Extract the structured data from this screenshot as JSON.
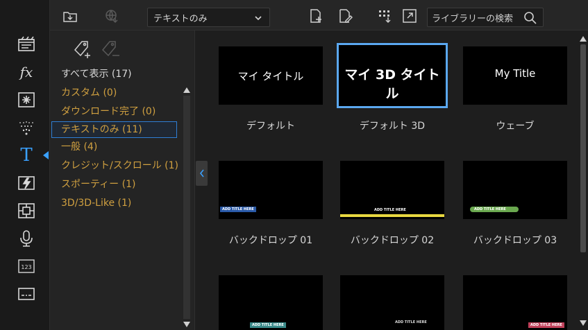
{
  "rail": {
    "items": [
      {
        "icon": "clapperboard-icon"
      },
      {
        "icon": "fx-icon",
        "text": "fx"
      },
      {
        "icon": "particle-icon"
      },
      {
        "icon": "sparkle-icon"
      },
      {
        "icon": "title-icon",
        "text": "T",
        "active": true
      },
      {
        "icon": "transition-icon"
      },
      {
        "icon": "pip-icon"
      },
      {
        "icon": "microphone-icon"
      },
      {
        "icon": "chapter-icon",
        "text": "123"
      },
      {
        "icon": "subtitle-icon"
      }
    ]
  },
  "toolbar": {
    "filter_value": "テキストのみ",
    "search_placeholder": "ライブラリーの検索"
  },
  "categories": [
    {
      "label": "すべて表示 (17)",
      "kind": "all"
    },
    {
      "label": "カスタム (0)"
    },
    {
      "label": "ダウンロード完了 (0)"
    },
    {
      "label": "テキストのみ (11)",
      "selected": true
    },
    {
      "label": "一般 (4)"
    },
    {
      "label": "クレジット/スクロール (1)"
    },
    {
      "label": "スポーティー (1)"
    },
    {
      "label": "3D/3D-Like (1)"
    }
  ],
  "tiles": [
    {
      "label": "デフォルト",
      "thumb_text": "マイ タイトル",
      "style": "plain"
    },
    {
      "label": "デフォルト 3D",
      "thumb_text": "マイ 3D タイトル",
      "style": "bold",
      "selected": true
    },
    {
      "label": "ウェーブ",
      "thumb_text": "My Title",
      "style": "plain"
    },
    {
      "label": "バックドロップ 01",
      "thumb_text": "ADD TITLE HERE",
      "style": "bd1"
    },
    {
      "label": "バックドロップ 02",
      "thumb_text": "ADD TITLE HERE",
      "style": "bd2"
    },
    {
      "label": "バックドロップ 03",
      "thumb_text": "ADD TITLE HERE",
      "style": "bd3"
    },
    {
      "label": "",
      "thumb_text": "ADD TITLE HERE",
      "style": "r3a"
    },
    {
      "label": "",
      "thumb_text": "ADD TITLE HERE",
      "style": "r3b"
    },
    {
      "label": "",
      "thumb_text": "ADD TITLE HERE",
      "style": "r3c"
    }
  ],
  "colors": {
    "accent": "#3aa0ff",
    "category_text": "#d0a040",
    "selection_outline": "#5ba8f0"
  }
}
